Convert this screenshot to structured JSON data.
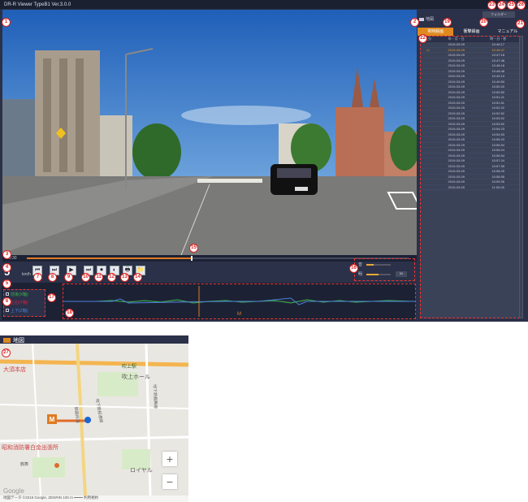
{
  "window": {
    "title": "DR-R Viewer TypeB1 Ver.3.0.0",
    "buttons": [
      "_",
      "□",
      "×"
    ]
  },
  "player": {
    "time": "00:30",
    "seek_progress": 0.43,
    "speed_value": "5",
    "speed_unit": "km/h",
    "buttons": [
      "⏮",
      "⏭",
      "▶",
      "⏭",
      "⏺",
      "◐",
      "🖶",
      "📁"
    ]
  },
  "sliders": {
    "volume_label": "音",
    "volume_level": 0.3,
    "volume_value": "",
    "brightness_label": "明",
    "brightness_level": 0.5,
    "brightness_value": "50"
  },
  "gsensor": {
    "legend": [
      "前後(X軸)",
      "左右(Y軸)",
      "上下(Z軸)"
    ],
    "legend_colors": [
      "#3cb44b",
      "#e6194b",
      "#4d7fd8"
    ],
    "marker": "M"
  },
  "right_panel": {
    "map_toggle": "地図",
    "folder_button": "フォルダー",
    "tabs": [
      "常時録画",
      "衝撃録画",
      "マニュアル"
    ],
    "list_headers": [
      "区分",
      "年・月・日",
      "時・分・秒"
    ],
    "files": [
      {
        "flag": "",
        "date": "2019-03-09",
        "time": "10:46:17"
      },
      {
        "flag": "M",
        "date": "2019-03-09",
        "time": "10:46:47"
      },
      {
        "flag": "",
        "date": "2019-03-09",
        "time": "10:47:18"
      },
      {
        "flag": "",
        "date": "2019-03-09",
        "time": "10:47:48"
      },
      {
        "flag": "",
        "date": "2019-03-09",
        "time": "10:48:18"
      },
      {
        "flag": "",
        "date": "2019-03-09",
        "time": "10:48:48"
      },
      {
        "flag": "",
        "date": "2019-03-09",
        "time": "10:49:19"
      },
      {
        "flag": "",
        "date": "2019-03-09",
        "time": "10:49:50"
      },
      {
        "flag": "",
        "date": "2019-03-09",
        "time": "10:50:20"
      },
      {
        "flag": "",
        "date": "2019-03-09",
        "time": "10:50:50"
      },
      {
        "flag": "",
        "date": "2019-03-09",
        "time": "10:51:21"
      },
      {
        "flag": "",
        "date": "2019-03-09",
        "time": "10:51:51"
      },
      {
        "flag": "",
        "date": "2019-03-09",
        "time": "10:52:22"
      },
      {
        "flag": "",
        "date": "2019-03-09",
        "time": "10:52:52"
      },
      {
        "flag": "",
        "date": "2019-03-09",
        "time": "10:53:22"
      },
      {
        "flag": "",
        "date": "2019-03-09",
        "time": "10:53:52"
      },
      {
        "flag": "",
        "date": "2019-03-09",
        "time": "10:54:23"
      },
      {
        "flag": "",
        "date": "2019-03-09",
        "time": "10:54:53"
      },
      {
        "flag": "",
        "date": "2019-03-09",
        "time": "10:55:23"
      },
      {
        "flag": "",
        "date": "2019-03-09",
        "time": "10:55:54"
      },
      {
        "flag": "",
        "date": "2019-03-09",
        "time": "10:56:24"
      },
      {
        "flag": "",
        "date": "2019-03-09",
        "time": "10:56:54"
      },
      {
        "flag": "",
        "date": "2019-03-09",
        "time": "10:57:24"
      },
      {
        "flag": "",
        "date": "2019-03-09",
        "time": "10:57:55"
      },
      {
        "flag": "",
        "date": "2019-03-09",
        "time": "10:58:25"
      },
      {
        "flag": "",
        "date": "2019-03-09",
        "time": "10:58:55"
      },
      {
        "flag": "",
        "date": "2019-03-09",
        "time": "10:59:26"
      },
      {
        "flag": "",
        "date": "2019-03-09",
        "time": "11:00:26"
      }
    ]
  },
  "map_window": {
    "title": "地図",
    "marker": "M",
    "labels": {
      "hall": "吹上ホール",
      "station": "吹上駅",
      "oosu": "大須本店",
      "fire": "昭和消防署白金出張所",
      "royal": "ロイヤル",
      "subway": "地下鉄桜通線",
      "subway2": "地下鉄鶴舞線",
      "rd": "御器所通",
      "rd2": "鶴舞"
    },
    "zoom_in": "+",
    "zoom_out": "−",
    "footer": "地図データ ©2019 Google, ZENRIN   100 m ━━━━   利用規約",
    "google": "Google"
  },
  "badges": [
    "1",
    "2",
    "3",
    "4",
    "5",
    "6",
    "7",
    "8",
    "9",
    "10",
    "11",
    "12",
    "13",
    "14",
    "15",
    "16",
    "17",
    "18",
    "19",
    "20",
    "21",
    "22",
    "23",
    "24",
    "25",
    "26",
    "27"
  ]
}
